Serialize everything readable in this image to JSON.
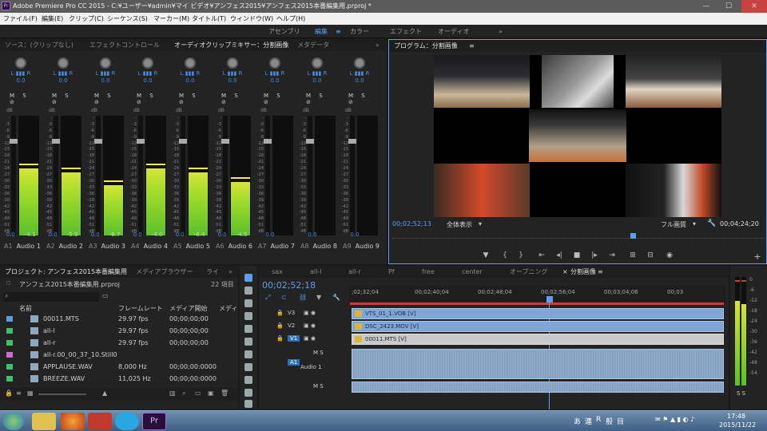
{
  "window": {
    "title": "Adobe Premiere Pro CC 2015 - C:¥ユーザー¥admin¥マイ ビデオ¥アンフェス2015¥アンフェス2015本番編集用.prproj *",
    "minimize": "—",
    "maximize": "☐",
    "close": "✕"
  },
  "menu": [
    "ファイル(F)",
    "編集(E)",
    "クリップ(C)",
    "シーケンス(S)",
    "マーカー(M)",
    "タイトル(T)",
    "ウィンドウ(W)",
    "ヘルプ(H)"
  ],
  "workspaces": [
    "アセンブリ",
    "編集",
    "カラー",
    "エフェクト",
    "オーディオ"
  ],
  "workspace_more": "»",
  "source_panel": {
    "tabs": [
      "ソース：(クリップなし)",
      "エフェクトコントロール",
      "オーディオクリップミキサー：分割画像",
      "メタデータ"
    ],
    "more": "»"
  },
  "mixer": {
    "db_label": "dB",
    "lr_label": "L ▮▮▮ R",
    "pan_value": "0.0",
    "ms_label": "M S ⊘",
    "scale": [
      "-",
      "-3",
      "-6",
      "-9",
      "-12",
      "-15",
      "-18",
      "-21",
      "-24",
      "-27",
      "-30",
      "-33",
      "-36",
      "-39",
      "-42",
      "-45",
      "-48",
      "-51",
      "dB"
    ],
    "channels": [
      {
        "id": "A1",
        "name": "Audio 1",
        "level": "-4.1",
        "volume": "0.0",
        "meter": 0.56
      },
      {
        "id": "A2",
        "name": "Audio 2",
        "level": "-5.9",
        "volume": "0.0",
        "meter": 0.53
      },
      {
        "id": "A3",
        "name": "Audio 3",
        "level": "-8.7",
        "volume": "0.0",
        "meter": 0.42
      },
      {
        "id": "A4",
        "name": "Audio 4",
        "level": "-4.0",
        "volume": "0.0",
        "meter": 0.56
      },
      {
        "id": "A5",
        "name": "Audio 5",
        "level": "-6.4",
        "volume": "0.0",
        "meter": 0.53
      },
      {
        "id": "A6",
        "name": "Audio 6",
        "level": "-4.5",
        "volume": "0.0",
        "meter": 0.45
      },
      {
        "id": "A7",
        "name": "Audio 7",
        "level": "",
        "volume": "0.0",
        "meter": 0
      },
      {
        "id": "A8",
        "name": "Audio 8",
        "level": "",
        "volume": "0.0",
        "meter": 0
      },
      {
        "id": "A9",
        "name": "Audio 9",
        "level": "",
        "volume": "0.0",
        "meter": 0
      }
    ]
  },
  "program": {
    "tab": "プログラム：分割画像",
    "timecode": "00;02;52;13",
    "fit": "全体表示",
    "quality": "フル画質",
    "duration": "00;04;24;20"
  },
  "project": {
    "tabs": [
      "プロジェクト: アンフェス2015本番編集用",
      "メディアブラウザー",
      "ライ"
    ],
    "more": "»",
    "file": "アンフェス2015本番編集用.prproj",
    "count": "22 項目",
    "search_placeholder": "",
    "columns": [
      "名前",
      "フレームレート",
      "メディア開始",
      "メディ"
    ],
    "rows": [
      {
        "name": "00011.MTS",
        "fps": "29.97 fps",
        "start": "00;00;00;00",
        "color": "#5b9be0"
      },
      {
        "name": "all-l",
        "fps": "29.97 fps",
        "start": "00;00;00;00",
        "color": "#3fbf6a"
      },
      {
        "name": "all-r",
        "fps": "29.97 fps",
        "start": "00;00;00;00",
        "color": "#3fbf6a"
      },
      {
        "name": "all-r.00_00_37_10.Still0",
        "fps": "",
        "start": "",
        "color": "#d06ad0"
      },
      {
        "name": "APPLAUSE.WAV",
        "fps": "8,000 Hz",
        "start": "00;00;00:0000",
        "color": "#3fbf6a"
      },
      {
        "name": "BREEZE.WAV",
        "fps": "11,025 Hz",
        "start": "00;00;00:0000",
        "color": "#3fbf6a"
      }
    ]
  },
  "timeline": {
    "tabs": [
      "sax",
      "all-l",
      "all-r",
      "Pf",
      "free",
      "center",
      "オープニング",
      "分割画像"
    ],
    "timecode": "00;02;52;18",
    "ruler": [
      ";02;32;04",
      "00;02;40;04",
      "00;02;48;04",
      "00;02;56;04",
      "00;03;04;06",
      "00;03"
    ],
    "tracks": [
      {
        "id": "V3",
        "clip": "VTS_01_1.VOB [V]"
      },
      {
        "id": "V2",
        "clip": "DSC_2423.MOV [V]"
      },
      {
        "id": "V1",
        "clip": "00011.MTS [V]"
      }
    ],
    "audio_track": {
      "id": "A1",
      "name": "Audio 1",
      "ms": "M S"
    },
    "audio_track2_ms": "M S"
  },
  "right_meter": {
    "scale": [
      "0",
      "-6",
      "-12",
      "-18",
      "-24",
      "-30",
      "-36",
      "-42",
      "-48",
      "-54"
    ],
    "solo": "S  S"
  },
  "taskbar": {
    "time": "17:48",
    "date": "2015/11/22",
    "ime": [
      "あ",
      "連",
      "R",
      "般",
      "目"
    ]
  }
}
